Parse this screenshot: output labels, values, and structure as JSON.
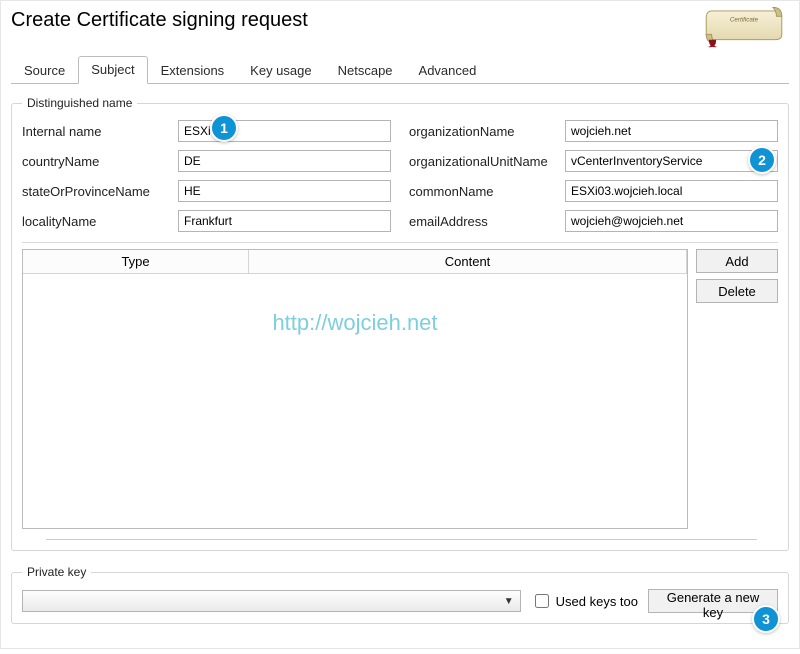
{
  "window": {
    "title": "Create Certificate signing request"
  },
  "tabs": [
    "Source",
    "Subject",
    "Extensions",
    "Key usage",
    "Netscape",
    "Advanced"
  ],
  "active_tab_index": 1,
  "groups": {
    "dn": {
      "title": "Distinguished name"
    },
    "pk": {
      "title": "Private key"
    }
  },
  "dn_left": [
    {
      "label": "Internal name",
      "name": "internal-name",
      "value": "ESXi03"
    },
    {
      "label": "countryName",
      "name": "country-name",
      "value": "DE"
    },
    {
      "label": "stateOrProvinceName",
      "name": "state-or-province",
      "value": "HE"
    },
    {
      "label": "localityName",
      "name": "locality-name",
      "value": "Frankfurt"
    }
  ],
  "dn_right": [
    {
      "label": "organizationName",
      "name": "organization-name",
      "value": "wojcieh.net"
    },
    {
      "label": "organizationalUnitName",
      "name": "organizational-unit-name",
      "value": "vCenterInventoryService"
    },
    {
      "label": "commonName",
      "name": "common-name",
      "value": "ESXi03.wojcieh.local"
    },
    {
      "label": "emailAddress",
      "name": "email-address",
      "value": "wojcieh@wojcieh.net"
    }
  ],
  "list": {
    "headers": [
      "Type",
      "Content"
    ]
  },
  "buttons": {
    "add": "Add",
    "delete": "Delete",
    "generate_key": "Generate a new key"
  },
  "private_key": {
    "selected": "",
    "used_keys_too_label": "Used keys too",
    "used_keys_too_checked": false
  },
  "watermark": "http://wojcieh.net",
  "badges": [
    "1",
    "2",
    "3"
  ]
}
